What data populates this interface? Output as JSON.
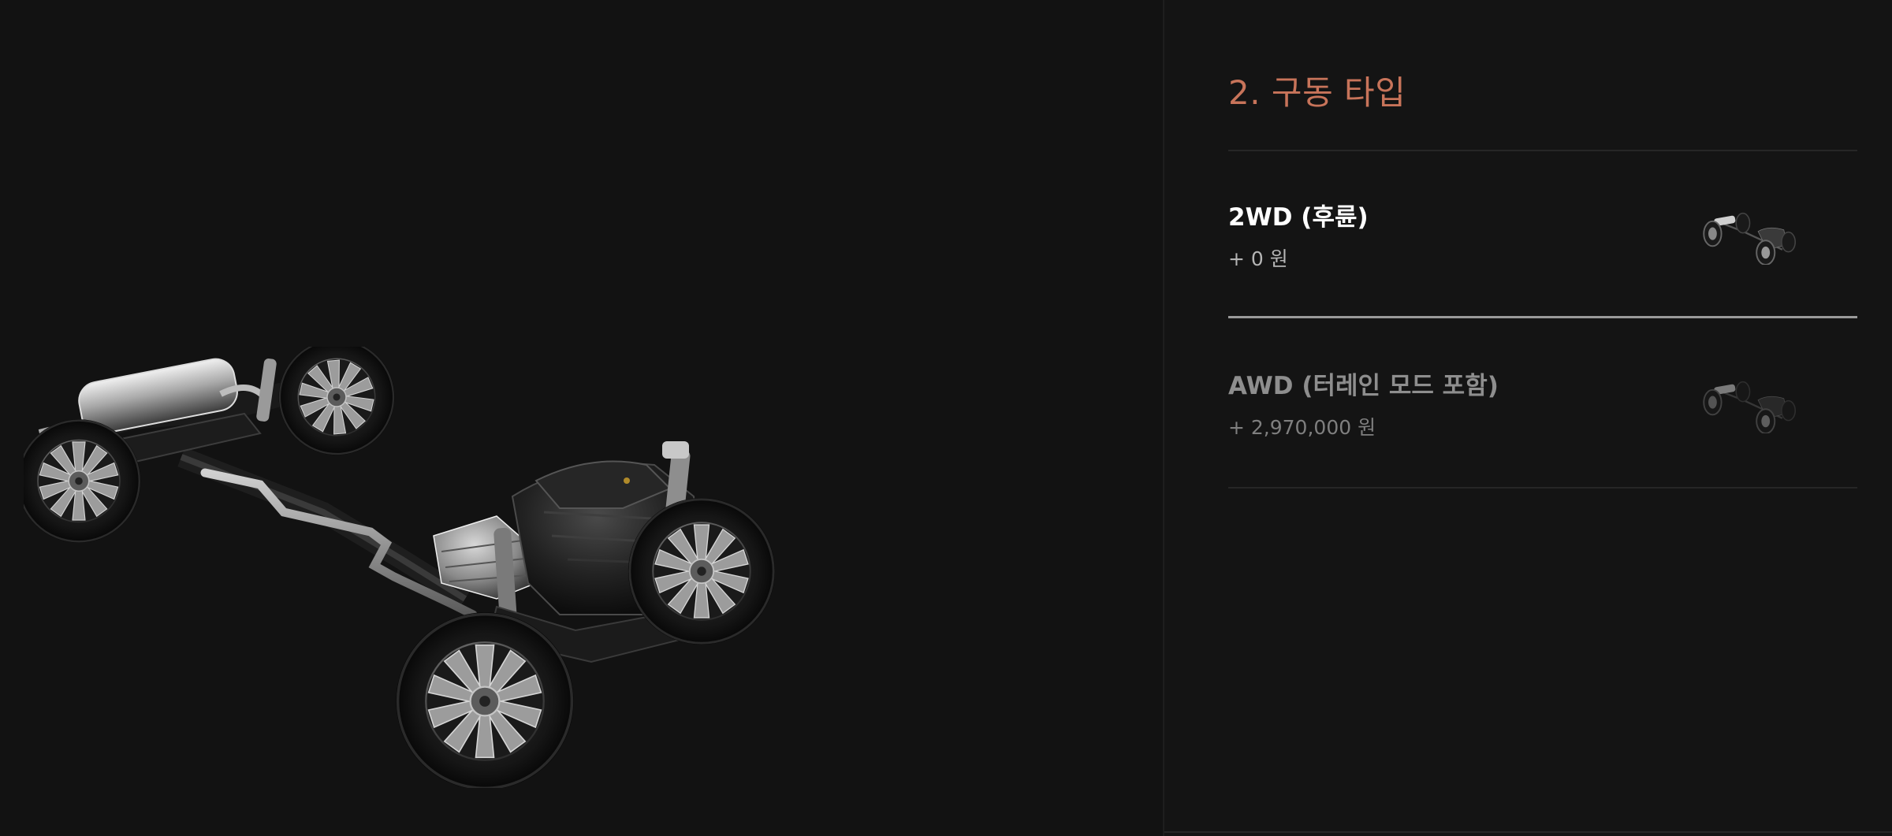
{
  "section": {
    "title": "2. 구동 타입"
  },
  "options": [
    {
      "name": "2WD (후륜)",
      "price": "+ 0 원",
      "selected": true,
      "thumbnail_icon": "chassis-rwd-thumbnail-icon"
    },
    {
      "name": "AWD (터레인 모드 포함)",
      "price": "+ 2,970,000 원",
      "selected": false,
      "thumbnail_icon": "chassis-awd-thumbnail-icon"
    }
  ],
  "preview": {
    "icon": "vehicle-chassis-drivetrain-icon"
  },
  "colors": {
    "background": "#121212",
    "panel": "#141414",
    "accent_title": "#c8745a",
    "selected_text": "#ffffff",
    "unselected_text": "#8e8e8e"
  }
}
